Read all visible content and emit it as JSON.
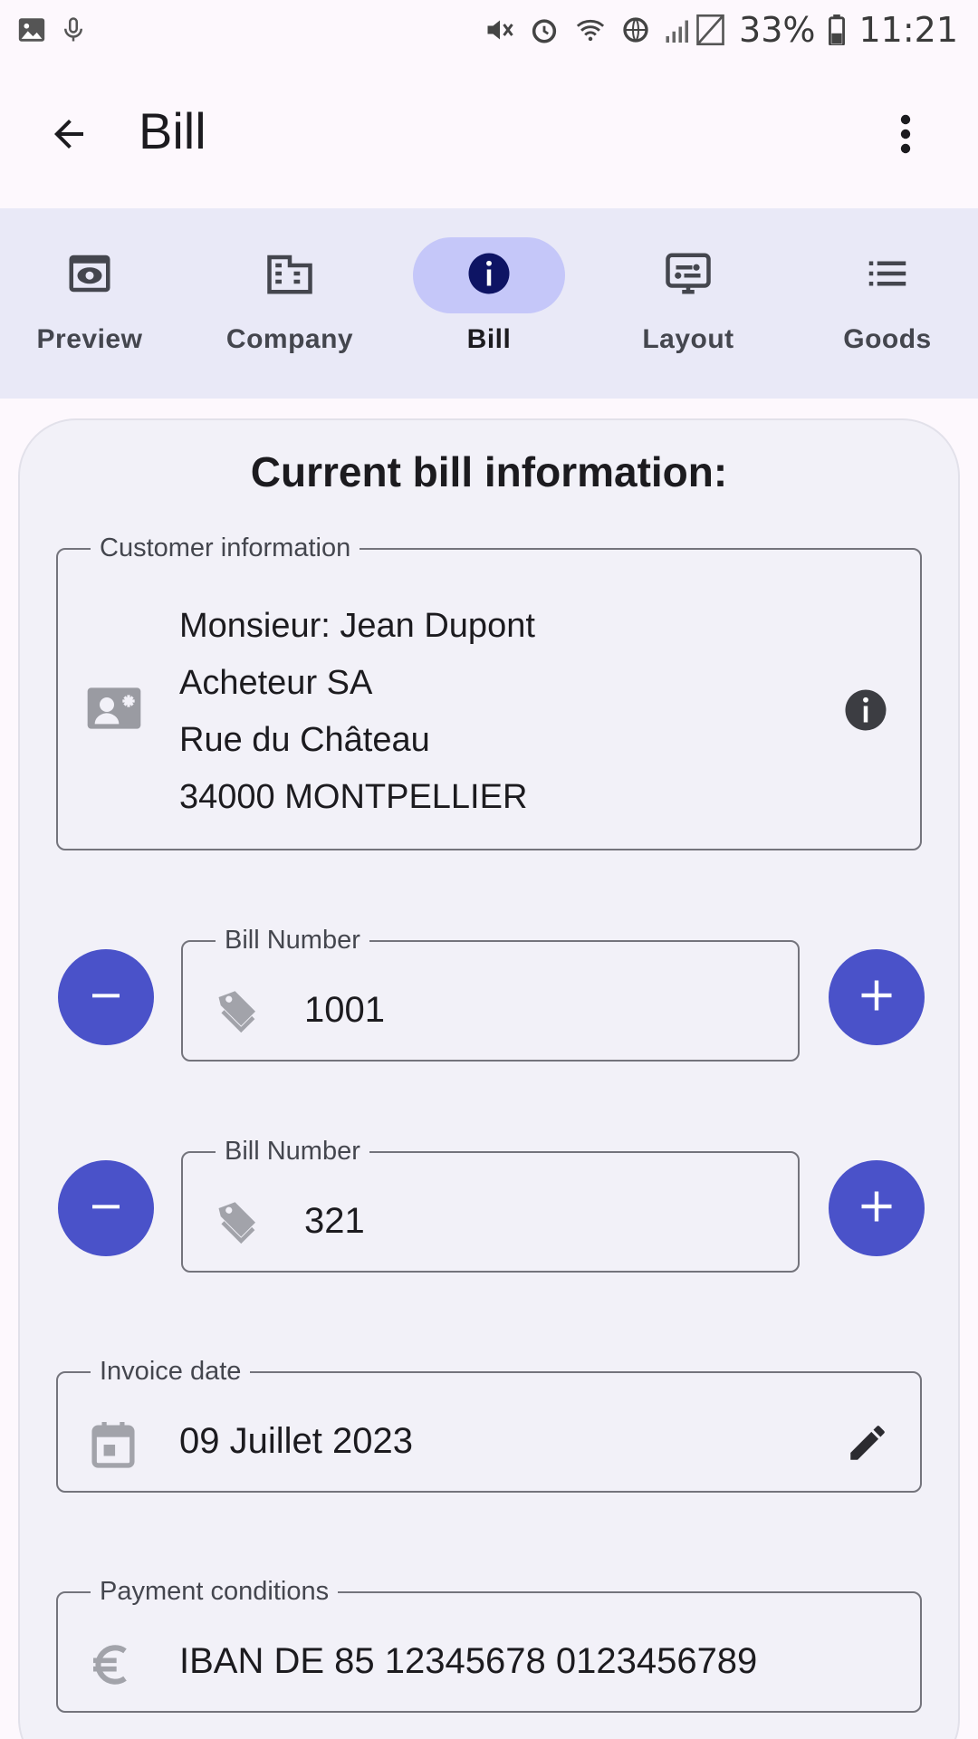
{
  "status_bar": {
    "battery_percent": "33%",
    "time": "11:21"
  },
  "app_bar": {
    "title": "Bill"
  },
  "nav": {
    "items": [
      {
        "label": "Preview",
        "icon": "eye-icon"
      },
      {
        "label": "Company",
        "icon": "building-icon"
      },
      {
        "label": "Bill",
        "icon": "info-icon",
        "active": true
      },
      {
        "label": "Layout",
        "icon": "layout-icon"
      },
      {
        "label": "Goods",
        "icon": "list-icon"
      }
    ]
  },
  "card": {
    "title": "Current bill information:",
    "customer": {
      "legend": "Customer information",
      "lines": [
        "Monsieur: Jean Dupont",
        "Acheteur SA",
        "Rue du Château",
        "34000 MONTPELLIER"
      ]
    },
    "bill_number_1": {
      "legend": "Bill Number",
      "value": "1001"
    },
    "bill_number_2": {
      "legend": "Bill Number",
      "value": "321"
    },
    "invoice_date": {
      "legend": "Invoice date",
      "value": "09 Juillet 2023"
    },
    "payment": {
      "legend": "Payment conditions",
      "value": "IBAN DE 85 12345678 0123456789"
    }
  },
  "colors": {
    "accent": "#4a52c9",
    "active_pill": "#c5c7f9",
    "nav_background": "#e9e9f7",
    "card_background": "#f2f1f8"
  }
}
